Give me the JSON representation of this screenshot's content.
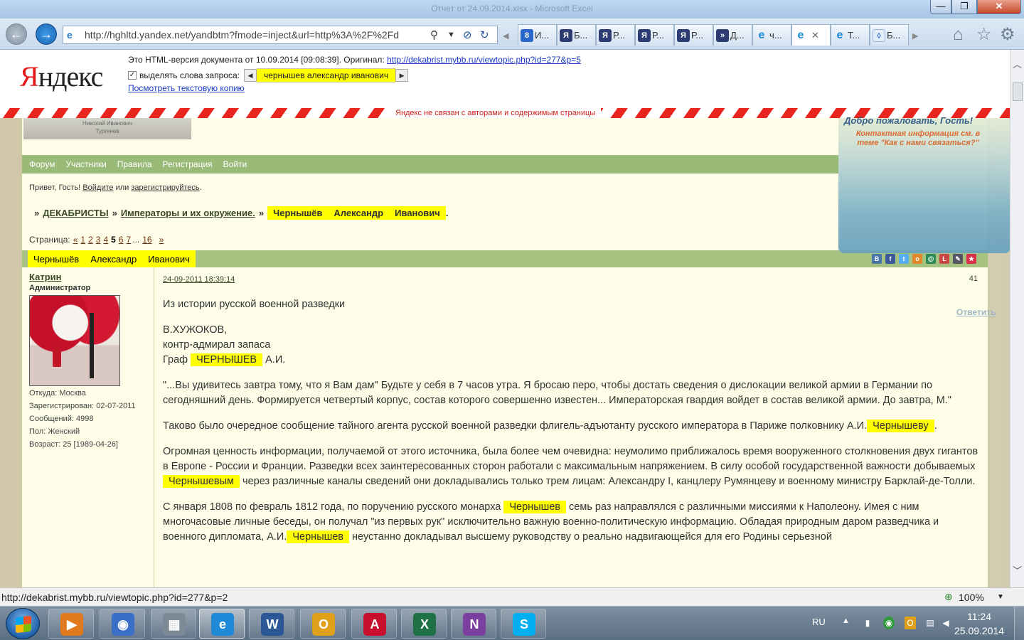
{
  "window": {
    "title": "Отчет от 24.09.2014.xlsx - Microsoft Excel",
    "min": "—",
    "max": "❐",
    "close": "✕"
  },
  "browser": {
    "address": "http://hghltd.yandex.net/yandbtm?fmode=inject&url=http%3A%2F%2Fd",
    "tabs": [
      {
        "icon": "8",
        "icon_class": "ic-g",
        "label": "И...",
        "active": false
      },
      {
        "icon": "Я",
        "icon_class": "ic-y",
        "label": "Б...",
        "active": false
      },
      {
        "icon": "Я",
        "icon_class": "ic-y",
        "label": "Р...",
        "active": false
      },
      {
        "icon": "Я",
        "icon_class": "ic-y",
        "label": "Р...",
        "active": false
      },
      {
        "icon": "Я",
        "icon_class": "ic-y",
        "label": "Р...",
        "active": false
      },
      {
        "icon": "»",
        "icon_class": "ic-y",
        "label": "Д...",
        "active": false
      },
      {
        "icon": "e",
        "icon_class": "ic-e",
        "label": "ч...",
        "active": false
      },
      {
        "icon": "e",
        "icon_class": "ic-e",
        "label": "",
        "active": true,
        "close": "✕"
      },
      {
        "icon": "e",
        "icon_class": "ic-e",
        "label": "Т...",
        "active": false
      },
      {
        "icon": "◊",
        "icon_class": "ic-s",
        "label": "Б...",
        "active": false
      }
    ]
  },
  "yandex": {
    "logo_first": "Я",
    "logo_rest": "ндекс",
    "note_prefix": "Это HTML-версия документа от 10.09.2014 [09:08:39]. Оригинал: ",
    "original_url": "http://dekabrist.mybb.ru/viewtopic.php?id=277&p=5",
    "highlight_label": "выделять слова запроса:",
    "query": "чернышев александр иванович",
    "text_copy": "Посмотреть текстовую копию",
    "disclaimer": "Яндекс не связан с авторами и содержимым страницы"
  },
  "forum": {
    "logo_line1": "Николай Иванович",
    "logo_line2": "Тургенев",
    "welcome_title": "Добро пожаловать, Гость!",
    "welcome_text": "Контактная информация см. в теме \"Как с нами связаться?\"",
    "reply": "Ответить",
    "menu": [
      "Форум",
      "Участники",
      "Правила",
      "Регистрация",
      "Войти"
    ],
    "greeting_prefix": "Привет, Гость!",
    "login_link": "Войдите",
    "greeting_or": "или",
    "register_link": "зарегистрируйтесь",
    "greeting_end": ".",
    "crumbs": {
      "sep": "»",
      "forum": "ДЕКАБРИСТЫ",
      "section": "Императоры и их окружение.",
      "topic": [
        "Чернышёв",
        "Александр",
        "Иванович"
      ],
      "end": "."
    },
    "pager": {
      "label": "Страница:",
      "prev": "«",
      "pages": [
        "1",
        "2",
        "3",
        "4"
      ],
      "current": "5",
      "next_pages": [
        "6",
        "7"
      ],
      "ellipsis": "...",
      "last": "16",
      "next": "»"
    },
    "topic_title": [
      "Чернышёв",
      "Александр",
      "Иванович"
    ],
    "share_icons": [
      {
        "name": "vk-icon",
        "glyph": "В",
        "color": "#4a76a8"
      },
      {
        "name": "facebook-icon",
        "glyph": "f",
        "color": "#3b5998"
      },
      {
        "name": "twitter-icon",
        "glyph": "t",
        "color": "#55acee"
      },
      {
        "name": "odnoklassniki-icon",
        "glyph": "o",
        "color": "#e0872a"
      },
      {
        "name": "moimir-icon",
        "glyph": "@",
        "color": "#2e8b57"
      },
      {
        "name": "liveinternet-icon",
        "glyph": "L",
        "color": "#c44"
      },
      {
        "name": "bookmark-icon",
        "glyph": "✎",
        "color": "#556"
      },
      {
        "name": "star-icon",
        "glyph": "★",
        "color": "#d9304a"
      }
    ]
  },
  "post": {
    "author": "Катрин",
    "role": "Администратор",
    "from": "Откуда: Москва",
    "registered": "Зарегистрирован: 02-07-2011",
    "messages": "Сообщений: 4998",
    "gender": "Пол: Женский",
    "age": "Возраст: 25 [1989-04-26]",
    "date": "24-09-2011 18:39:14",
    "number": "41",
    "heading": "Из истории русской военной разведки",
    "author_line1": "В.ХУЖОКОВ,",
    "author_line2": "контр-адмирал запаса",
    "author_line3_a": "Граф",
    "author_line3_hl": "ЧЕРНЫШЕВ",
    "author_line3_b": "А.И.",
    "p1": "\"...Вы удивитесь завтра тому, что я Вам дам\" Будьте у себя в 7 часов утра. Я бросаю перо, чтобы достать сведения о дислокации великой армии в Германии по сегодняшний день. Формируется четвертый корпус, состав которого совершенно известен... Императорская гвардия войдет в состав великой армии. До завтра, М.\"",
    "p2_a": "Таково было очередное сообщение тайного агента русской военной разведки флигель-адъютанту русского императора в Париже полковнику А.И.",
    "p2_hl": "Чернышеву",
    "p2_b": ".",
    "p3_a": "Огромная ценность информации, получаемой от этого источника, была более чем очевидна: неумолимо приближалось время вооруженного столкновения двух гигантов в Европе - России и Франции. Разведки всех заинтересованных сторон работали с максимальным напряжением. В силу особой государственной важности добываемых",
    "p3_hl": "Чернышевым",
    "p3_b": "через различные каналы сведений они докладывались только трем лицам: Александру I, канцлеру Румянцеву и военному министру Барклай-де-Толли.",
    "p4_a": "С января 1808 по февраль 1812 года, по поручению русского монарха",
    "p4_hl1": "Чернышев",
    "p4_b": "семь раз направлялся с различными миссиями к Наполеону. Имея с ним многочасовые личные беседы, он получал \"из первых рук\" исключительно важную военно-политическую информацию. Обладая природным даром разведчика и военного дипломата, А.И.",
    "p4_hl2": "Чернышев",
    "p4_c": "неустанно докладывал высшему руководству о реально надвигающейся для его Родины серьезной"
  },
  "status": {
    "url": "http://dekabrist.mybb.ru/viewtopic.php?id=277&p=2",
    "zoom": "100%"
  },
  "taskbar": {
    "apps": [
      {
        "name": "media-player-app",
        "glyph": "▶",
        "color": "#e07a1c"
      },
      {
        "name": "media-center-app",
        "glyph": "◉",
        "color": "#3b6fc7"
      },
      {
        "name": "calculator-app",
        "glyph": "▦",
        "color": "#7c8a96"
      },
      {
        "name": "internet-explorer-app",
        "glyph": "e",
        "color": "#1e89d6",
        "active": true
      },
      {
        "name": "word-app",
        "glyph": "W",
        "color": "#2b5797"
      },
      {
        "name": "outlook-app",
        "glyph": "O",
        "color": "#e0a01c"
      },
      {
        "name": "acrobat-app",
        "glyph": "A",
        "color": "#c8102e"
      },
      {
        "name": "excel-app",
        "glyph": "X",
        "color": "#1e7145"
      },
      {
        "name": "onenote-app",
        "glyph": "N",
        "color": "#7b3fa0"
      },
      {
        "name": "skype-app",
        "glyph": "S",
        "color": "#00aff0"
      }
    ],
    "lang": "RU",
    "time": "11:24",
    "date": "25.09.2014"
  }
}
